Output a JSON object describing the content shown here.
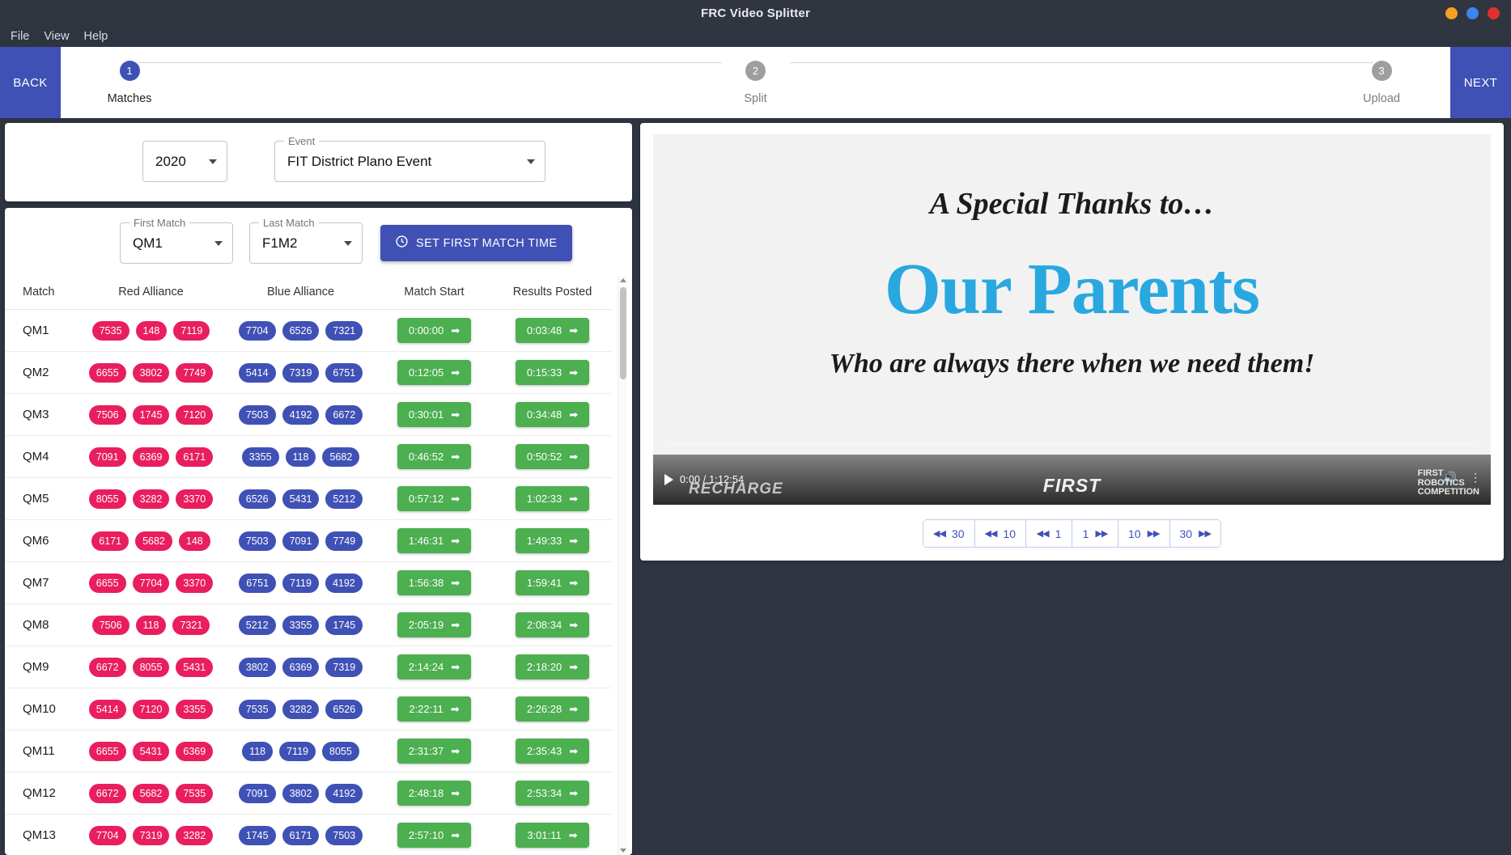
{
  "window": {
    "title": "FRC Video Splitter",
    "controls": [
      {
        "name": "minimize",
        "color": "#f6a020"
      },
      {
        "name": "maximize",
        "color": "#3b86f0"
      },
      {
        "name": "close",
        "color": "#e0302f"
      }
    ]
  },
  "menubar": {
    "items": [
      "File",
      "View",
      "Help"
    ]
  },
  "wizard": {
    "back_label": "BACK",
    "next_label": "NEXT",
    "steps": [
      {
        "number": "1",
        "label": "Matches",
        "active": true
      },
      {
        "number": "2",
        "label": "Split",
        "active": false
      },
      {
        "number": "3",
        "label": "Upload",
        "active": false
      }
    ]
  },
  "event_card": {
    "year": {
      "legend": "",
      "value": "2020"
    },
    "event": {
      "legend": "Event",
      "value": "FIT District Plano Event"
    }
  },
  "match_controls": {
    "first_match": {
      "legend": "First Match",
      "value": "QM1"
    },
    "last_match": {
      "legend": "Last Match",
      "value": "F1M2"
    },
    "set_time_button": "SET FIRST MATCH TIME",
    "clock_icon": "clock-icon"
  },
  "table": {
    "headers": [
      "Match",
      "Red Alliance",
      "Blue Alliance",
      "Match Start",
      "Results Posted"
    ],
    "rows": [
      {
        "match": "QM1",
        "red": [
          "7535",
          "148",
          "7119"
        ],
        "blue": [
          "7704",
          "6526",
          "7321"
        ],
        "start": "0:00:00",
        "results": "0:03:48"
      },
      {
        "match": "QM2",
        "red": [
          "6655",
          "3802",
          "7749"
        ],
        "blue": [
          "5414",
          "7319",
          "6751"
        ],
        "start": "0:12:05",
        "results": "0:15:33"
      },
      {
        "match": "QM3",
        "red": [
          "7506",
          "1745",
          "7120"
        ],
        "blue": [
          "7503",
          "4192",
          "6672"
        ],
        "start": "0:30:01",
        "results": "0:34:48"
      },
      {
        "match": "QM4",
        "red": [
          "7091",
          "6369",
          "6171"
        ],
        "blue": [
          "3355",
          "118",
          "5682"
        ],
        "start": "0:46:52",
        "results": "0:50:52"
      },
      {
        "match": "QM5",
        "red": [
          "8055",
          "3282",
          "3370"
        ],
        "blue": [
          "6526",
          "5431",
          "5212"
        ],
        "start": "0:57:12",
        "results": "1:02:33"
      },
      {
        "match": "QM6",
        "red": [
          "6171",
          "5682",
          "148"
        ],
        "blue": [
          "7503",
          "7091",
          "7749"
        ],
        "start": "1:46:31",
        "results": "1:49:33"
      },
      {
        "match": "QM7",
        "red": [
          "6655",
          "7704",
          "3370"
        ],
        "blue": [
          "6751",
          "7119",
          "4192"
        ],
        "start": "1:56:38",
        "results": "1:59:41"
      },
      {
        "match": "QM8",
        "red": [
          "7506",
          "118",
          "7321"
        ],
        "blue": [
          "5212",
          "3355",
          "1745"
        ],
        "start": "2:05:19",
        "results": "2:08:34"
      },
      {
        "match": "QM9",
        "red": [
          "6672",
          "8055",
          "5431"
        ],
        "blue": [
          "3802",
          "6369",
          "7319"
        ],
        "start": "2:14:24",
        "results": "2:18:20"
      },
      {
        "match": "QM10",
        "red": [
          "5414",
          "7120",
          "3355"
        ],
        "blue": [
          "7535",
          "3282",
          "6526"
        ],
        "start": "2:22:11",
        "results": "2:26:28"
      },
      {
        "match": "QM11",
        "red": [
          "6655",
          "5431",
          "6369"
        ],
        "blue": [
          "118",
          "7119",
          "8055"
        ],
        "start": "2:31:37",
        "results": "2:35:43"
      },
      {
        "match": "QM12",
        "red": [
          "6672",
          "5682",
          "7535"
        ],
        "blue": [
          "7091",
          "3802",
          "4192"
        ],
        "start": "2:48:18",
        "results": "2:53:34"
      },
      {
        "match": "QM13",
        "red": [
          "7704",
          "7319",
          "3282"
        ],
        "blue": [
          "1745",
          "6171",
          "7503"
        ],
        "start": "2:57:10",
        "results": "3:01:11"
      }
    ]
  },
  "video": {
    "slide": {
      "line1": "A Special Thanks to…",
      "line2": "Our Parents",
      "line3": "Who are always there when we need them!"
    },
    "time_display": "0:00 / 1:12:54",
    "brand_recharge": "RECHARGE",
    "brand_first": "FIRST",
    "brand_frc_line1": "FIRST",
    "brand_frc_line2": "ROBOTICS",
    "brand_frc_line3": "COMPETITION",
    "seek_buttons": [
      {
        "label": "30",
        "direction": "back"
      },
      {
        "label": "10",
        "direction": "back"
      },
      {
        "label": "1",
        "direction": "back"
      },
      {
        "label": "1",
        "direction": "forward"
      },
      {
        "label": "10",
        "direction": "forward"
      },
      {
        "label": "30",
        "direction": "forward"
      }
    ]
  },
  "colors": {
    "primary": "#3f51b5",
    "red_alliance": "#e91e5e",
    "blue_alliance": "#3f51b5",
    "time_green": "#4caf50",
    "accent_cyan": "#29a8e0"
  }
}
